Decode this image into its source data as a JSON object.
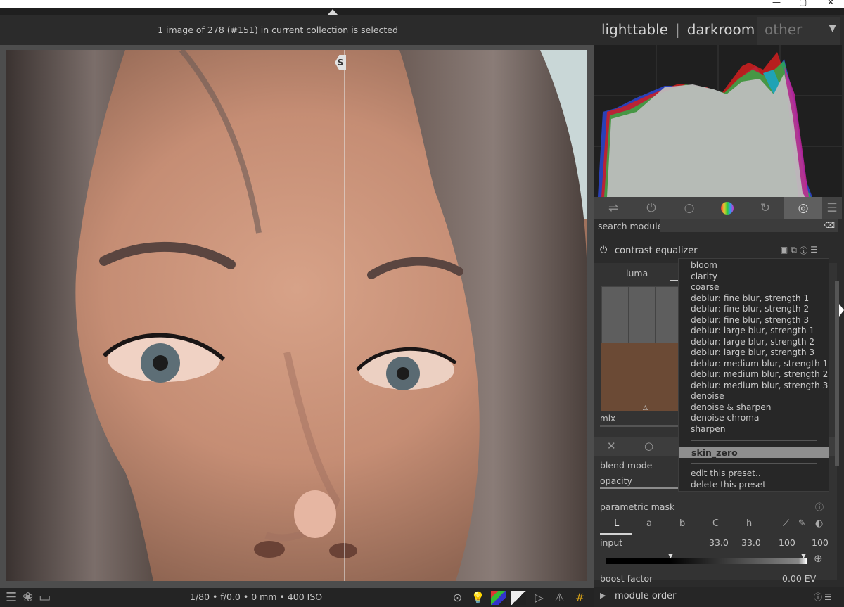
{
  "window": {
    "controls": [
      "—",
      "▢",
      "✕"
    ]
  },
  "header": {
    "collection_info": "1 image of 278 (#151) in current collection is selected",
    "views": [
      "lighttable",
      "darkroom",
      "other"
    ],
    "view_sep": "|"
  },
  "center": {
    "split_marker": "S"
  },
  "bottombar": {
    "exif": "1/80 • f/0.0 • 0 mm • 400 ISO"
  },
  "right": {
    "search_label": "search module",
    "module_title": "contrast equalizer",
    "tab_luma": "luma",
    "mix_label": "mix",
    "blend_mode_label": "blend mode",
    "opacity_label": "opacity",
    "parametric_mask_label": "parametric mask",
    "channels": [
      "L",
      "a",
      "b",
      "C",
      "h"
    ],
    "input_label": "input",
    "input_values": [
      "33.0",
      "33.0",
      "100",
      "100"
    ],
    "boost_label": "boost factor",
    "boost_value": "0.00 EV",
    "module_order_label": "module order"
  },
  "presets_menu": {
    "items": [
      "bloom",
      "clarity",
      "coarse",
      "deblur: fine blur, strength 1",
      "deblur: fine blur, strength 2",
      "deblur: fine blur, strength 3",
      "deblur: large blur, strength 1",
      "deblur: large blur, strength 2",
      "deblur: large blur, strength 3",
      "deblur: medium blur, strength 1",
      "deblur: medium blur, strength 2",
      "deblur: medium blur, strength 3",
      "denoise",
      "denoise & sharpen",
      "denoise chroma",
      "sharpen"
    ],
    "selected": "skin_zero",
    "actions": [
      "edit this preset..",
      "delete this preset"
    ]
  },
  "colors": {
    "panel_bg": "#2b2b2b",
    "histogram_bg": "#1f1f1f",
    "selection_bg": "#8e8e8e"
  }
}
